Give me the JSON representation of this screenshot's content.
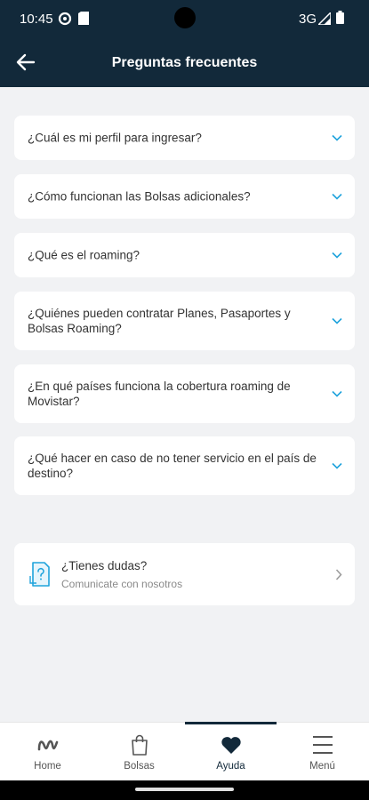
{
  "status_bar": {
    "time": "10:45",
    "network": "3G"
  },
  "app_bar": {
    "title": "Preguntas frecuentes"
  },
  "faq": [
    {
      "question": "¿Cuál es mi perfil para ingresar?"
    },
    {
      "question": "¿Cómo funcionan las Bolsas adicionales?"
    },
    {
      "question": "¿Qué es el roaming?"
    },
    {
      "question": "¿Quiénes pueden contratar Planes, Pasaportes y Bolsas Roaming?"
    },
    {
      "question": "¿En qué países funciona la cobertura roaming de Movistar?"
    },
    {
      "question": "¿Qué hacer en caso de no tener servicio en el país de destino?"
    }
  ],
  "contact": {
    "title": "¿Tienes dudas?",
    "subtitle": "Comunicate con nosotros"
  },
  "bottom_nav": {
    "items": [
      {
        "label": "Home",
        "icon": "movistar-logo-icon"
      },
      {
        "label": "Bolsas",
        "icon": "shopping-bag-icon"
      },
      {
        "label": "Ayuda",
        "icon": "heart-icon",
        "active": true
      },
      {
        "label": "Menú",
        "icon": "hamburger-menu-icon"
      }
    ]
  },
  "colors": {
    "header": "#12293a",
    "accent": "#1fa3dc",
    "background": "#f1f2f4"
  }
}
